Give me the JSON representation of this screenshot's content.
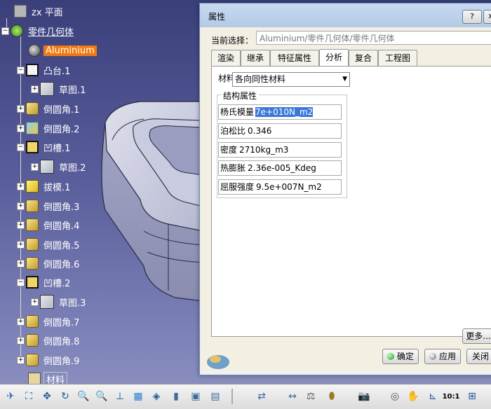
{
  "tree": {
    "items": [
      {
        "label": "zx 平面",
        "icon": "plane-icon"
      },
      {
        "label": "零件几何体",
        "icon": "body-icon"
      },
      {
        "label": "Aluminium",
        "icon": "material-icon"
      },
      {
        "label": "凸台.1",
        "icon": "pad-icon"
      },
      {
        "label": "草图.1",
        "icon": "sketch-icon"
      },
      {
        "label": "倒圆角.1",
        "icon": "fillet-icon"
      },
      {
        "label": "倒圆角.2",
        "icon": "fillet-icon"
      },
      {
        "label": "凹槽.1",
        "icon": "pocket-icon"
      },
      {
        "label": "草图.2",
        "icon": "sketch-icon"
      },
      {
        "label": "拔模.1",
        "icon": "draft-icon"
      },
      {
        "label": "倒圆角.3",
        "icon": "fillet-icon"
      },
      {
        "label": "倒圆角.4",
        "icon": "fillet-icon"
      },
      {
        "label": "倒圆角.5",
        "icon": "fillet-icon"
      },
      {
        "label": "倒圆角.6",
        "icon": "fillet-icon"
      },
      {
        "label": "凹槽.2",
        "icon": "pocket-icon"
      },
      {
        "label": "草图.3",
        "icon": "sketch-icon"
      },
      {
        "label": "倒圆角.7",
        "icon": "fillet-icon"
      },
      {
        "label": "倒圆角.8",
        "icon": "fillet-icon"
      },
      {
        "label": "倒圆角.9",
        "icon": "fillet-icon"
      },
      {
        "label": "材料",
        "icon": "material-library-icon"
      }
    ]
  },
  "dialog": {
    "title": "属性",
    "help_btn": "?",
    "close_btn": "✕",
    "current_selection_label": "当前选择：",
    "current_selection_value": "Aluminium/零件几何体/零件几何体",
    "tabs": [
      "渲染",
      "继承",
      "特征属性",
      "分析",
      "复合",
      "工程图"
    ],
    "material_label": "材料",
    "material_value": "各向同性材料",
    "group_title": "结构属性",
    "properties": [
      {
        "label": "杨氏模量",
        "value": "7e+010N_m2"
      },
      {
        "label": "泊松比",
        "value": "0.346"
      },
      {
        "label": "密度",
        "value": "2710kg_m3"
      },
      {
        "label": "热膨胀",
        "value": "2.36e-005_Kdeg"
      },
      {
        "label": "屈服强度",
        "value": "9.5e+007N_m2"
      }
    ],
    "more_btn": "更多...",
    "ok_btn": "确定",
    "apply_btn": "应用",
    "close_label": "关闭"
  },
  "toolbar": {
    "zoom_label": "10:1"
  },
  "colors": {
    "selection": "#f07a10",
    "viewport_bg": "#5a5f9c",
    "field_highlight": "#3a78d8"
  }
}
